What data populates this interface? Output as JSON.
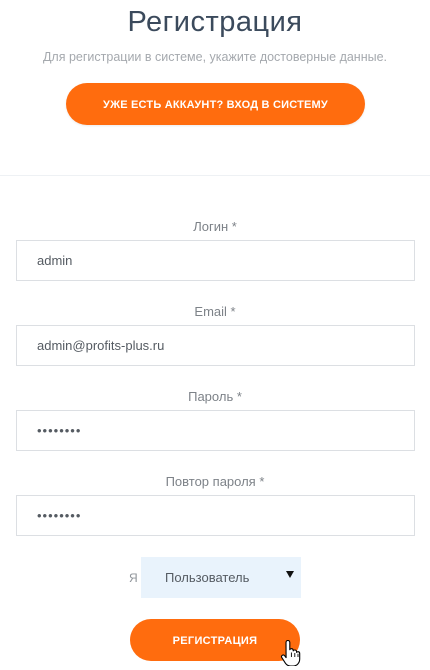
{
  "header": {
    "title": "Регистрация",
    "subtitle": "Для регистрации в системе, укажите достоверные данные."
  },
  "login_link": {
    "label": "УЖЕ ЕСТЬ АККАУНТ? ВХОД В СИСТЕМУ"
  },
  "form": {
    "login": {
      "label": "Логин *",
      "value": "admin"
    },
    "email": {
      "label": "Email *",
      "value": "admin@profits-plus.ru"
    },
    "password": {
      "label": "Пароль *",
      "value": "12345678"
    },
    "password_repeat": {
      "label": "Повтор пароля *",
      "value": "12345678"
    },
    "role": {
      "prefix": "Я",
      "selected": "Пользователь",
      "caret_icon": "caret-down-icon"
    },
    "submit_label": "РЕГИСТРАЦИЯ"
  },
  "cursor": {
    "icon": "hand-pointer-icon"
  },
  "colors": {
    "accent": "#ff6c0e",
    "select_background": "#e9f3fc",
    "title": "#3b4a5c"
  }
}
